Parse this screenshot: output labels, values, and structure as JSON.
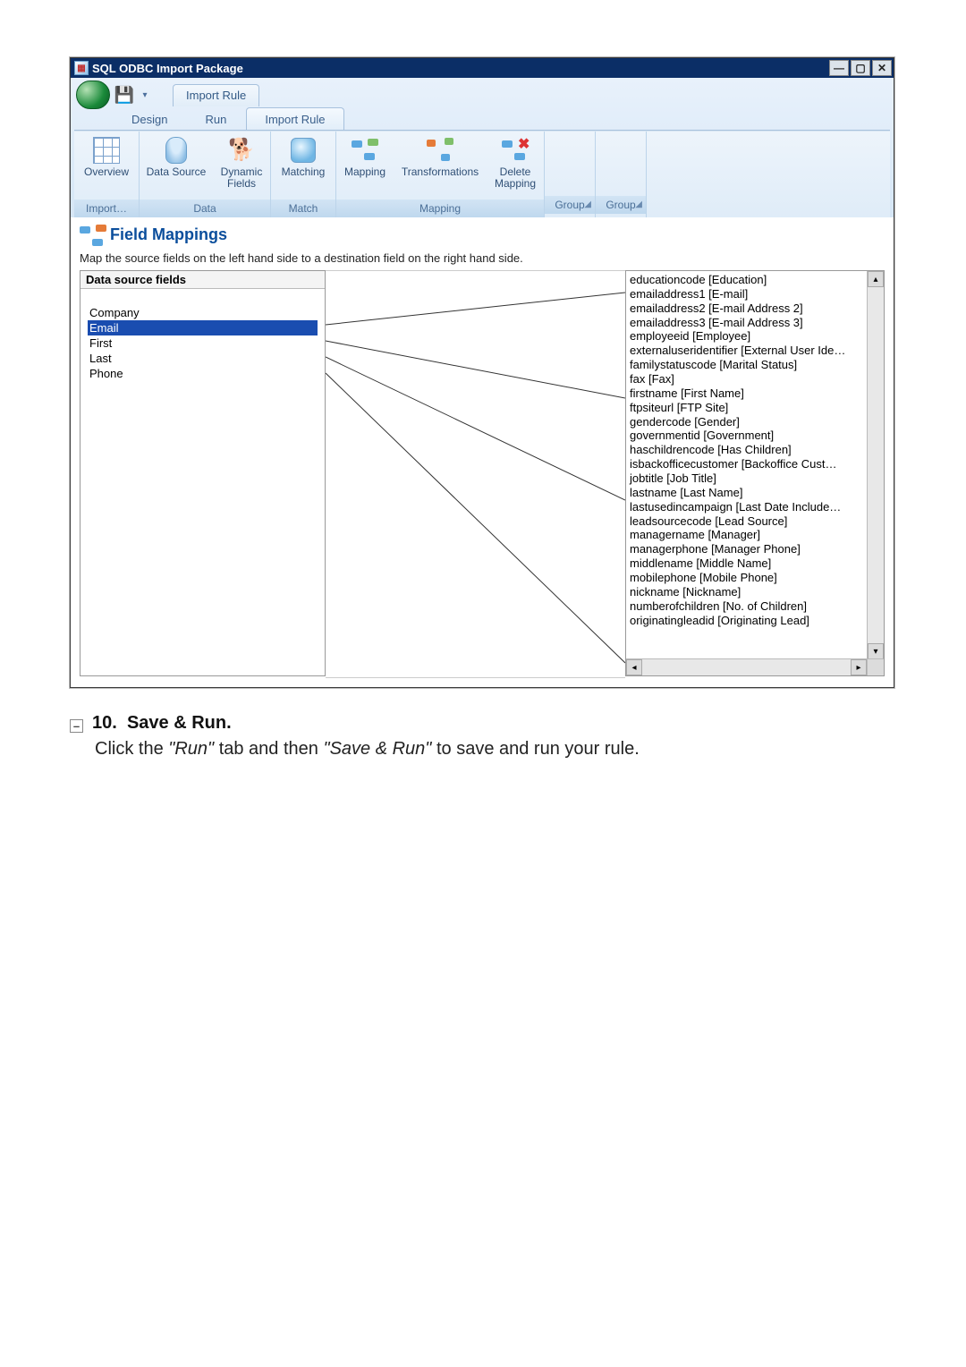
{
  "window": {
    "title": "SQL ODBC Import Package"
  },
  "ribbon": {
    "primary_tab": "Import Rule",
    "subtabs": {
      "design": "Design",
      "run": "Run",
      "active": "Import Rule"
    },
    "groups": {
      "import": {
        "label": "Import…",
        "overview": "Overview"
      },
      "data": {
        "label": "Data",
        "data_source": "Data Source",
        "dynamic_fields_l1": "Dynamic",
        "dynamic_fields_l2": "Fields"
      },
      "match": {
        "label": "Match",
        "matching": "Matching"
      },
      "mapping": {
        "label": "Mapping",
        "mapping": "Mapping",
        "transformations": "Transformations",
        "delete_l1": "Delete",
        "delete_l2": "Mapping"
      },
      "group_a": {
        "label": "Group"
      },
      "group_b": {
        "label": "Group"
      }
    }
  },
  "panel": {
    "title": "Field Mappings",
    "desc": "Map the source fields on the left hand side to a destination field on the right hand side."
  },
  "source": {
    "header": "Data source fields",
    "fields": [
      "Company",
      "Email",
      "First",
      "Last",
      "Phone"
    ],
    "selected": "Email"
  },
  "destination": {
    "fields": [
      "educationcode [Education]",
      "emailaddress1 [E-mail]",
      "emailaddress2 [E-mail Address 2]",
      "emailaddress3 [E-mail Address 3]",
      "employeeid [Employee]",
      "externaluseridentifier [External User Ide…",
      "familystatuscode [Marital Status]",
      "fax [Fax]",
      "firstname [First Name]",
      "ftpsiteurl [FTP Site]",
      "gendercode [Gender]",
      "governmentid [Government]",
      "haschildrencode [Has Children]",
      "isbackofficecustomer [Backoffice Cust…",
      "jobtitle [Job Title]",
      "lastname [Last Name]",
      "lastusedincampaign [Last Date Include…",
      "leadsourcecode [Lead Source]",
      "managername [Manager]",
      "managerphone [Manager Phone]",
      "middlename [Middle Name]",
      "mobilephone [Mobile Phone]",
      "nickname [Nickname]",
      "numberofchildren [No. of Children]",
      "originatingleadid [Originating Lead]"
    ]
  },
  "doc": {
    "step_number": "10.",
    "step_title": "Save & Run.",
    "body_pre": "Click the ",
    "body_em1": "\"Run\"",
    "body_mid": " tab and then ",
    "body_em2": "\"Save & Run\"",
    "body_post": " to save and run your rule."
  }
}
